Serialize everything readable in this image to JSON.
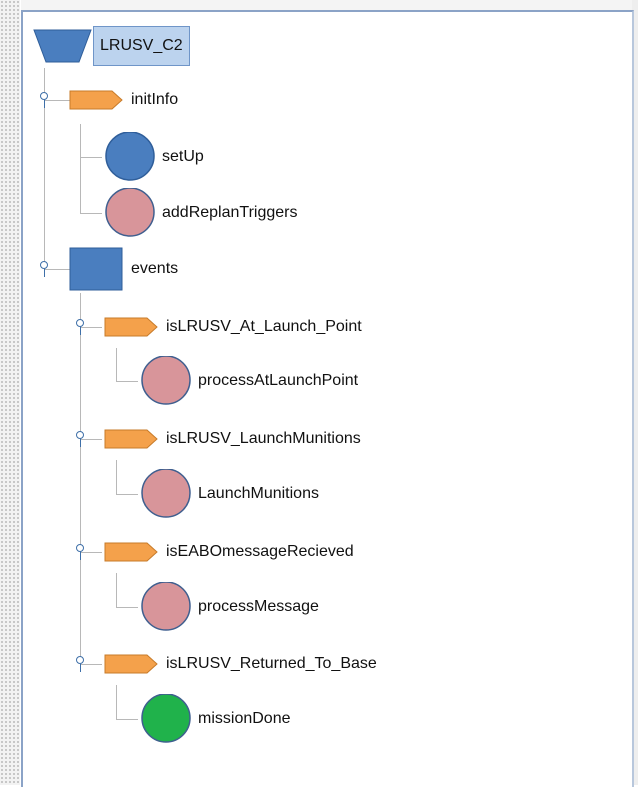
{
  "tree": {
    "root": {
      "label": "LRUSV_C2",
      "icon": "trapezoid-icon",
      "color": "#4a7ebf"
    },
    "initInfo": {
      "label": "initInfo",
      "icon": "arrow-tag-icon",
      "color": "#f4a14b",
      "children": [
        {
          "label": "setUp",
          "icon": "circle-icon",
          "color": "#4a7ebf"
        },
        {
          "label": "addReplanTriggers",
          "icon": "circle-icon",
          "color": "#d8959a"
        }
      ]
    },
    "events": {
      "label": "events",
      "icon": "square-icon",
      "color": "#4a7ebf",
      "children": [
        {
          "label": "isLRUSV_At_Launch_Point",
          "icon": "arrow-tag-icon",
          "color": "#f4a14b",
          "child": {
            "label": "processAtLaunchPoint",
            "icon": "circle-icon",
            "color": "#d8959a"
          }
        },
        {
          "label": "isLRUSV_LaunchMunitions",
          "icon": "arrow-tag-icon",
          "color": "#f4a14b",
          "child": {
            "label": "LaunchMunitions",
            "icon": "circle-icon",
            "color": "#d8959a"
          }
        },
        {
          "label": "isEABOmessageRecieved",
          "icon": "arrow-tag-icon",
          "color": "#f4a14b",
          "child": {
            "label": "processMessage",
            "icon": "circle-icon",
            "color": "#d8959a"
          }
        },
        {
          "label": "isLRUSV_Returned_To_Base",
          "icon": "arrow-tag-icon",
          "color": "#f4a14b",
          "child": {
            "label": "missionDone",
            "icon": "circle-icon",
            "color": "#20b24b"
          }
        }
      ]
    }
  }
}
